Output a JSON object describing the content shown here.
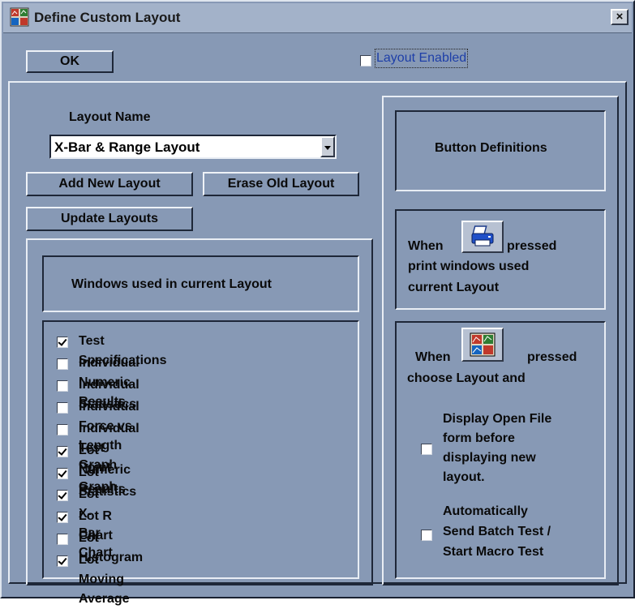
{
  "window": {
    "title": "Define Custom Layout",
    "close_label": "×"
  },
  "top_bar": {
    "ok_label": "OK",
    "layout_enabled_label": "Layout Enabled",
    "layout_enabled_checked": false
  },
  "layout": {
    "name_label": "Layout Name",
    "selected_layout": "X-Bar & Range Layout",
    "add_button": "Add New Layout",
    "erase_button": "Erase Old Layout",
    "update_button": "Update Layouts"
  },
  "windows_panel": {
    "heading": "Windows used in current Layout",
    "items": [
      {
        "label": "Test Specifications",
        "checked": true
      },
      {
        "label": "Individual Numeric Results",
        "checked": false
      },
      {
        "label": "Individual Statistics",
        "checked": false
      },
      {
        "label": "Individual Force vs Length Graph",
        "checked": false
      },
      {
        "label": "Individual Test Point Graph",
        "checked": false
      },
      {
        "label": "Lot Numeric Results",
        "checked": true
      },
      {
        "label": "Lot Statistics",
        "checked": true
      },
      {
        "label": "Lot X-Bar Chart",
        "checked": true
      },
      {
        "label": "Lot R Chart",
        "checked": true
      },
      {
        "label": "Lot Histogram",
        "checked": false
      },
      {
        "label": "Lot Moving Average",
        "checked": true
      }
    ]
  },
  "button_definitions": {
    "heading": "Button Definitions",
    "print_when": "When",
    "print_pressed": "pressed",
    "print_line2": "print windows used",
    "print_line3": "current Layout",
    "layout_when": "When",
    "layout_pressed": "pressed",
    "layout_line2": "choose Layout and",
    "open_file_option": {
      "lines": [
        "Display Open File",
        "form before",
        "displaying new",
        "layout."
      ],
      "checked": false
    },
    "batch_option": {
      "lines": [
        "Automatically",
        "Send Batch Test /",
        "Start Macro Test"
      ],
      "checked": false
    }
  },
  "icons": {
    "app": "layout-grid-icon",
    "printer": "printer-icon",
    "layout": "layout-grid-icon"
  }
}
